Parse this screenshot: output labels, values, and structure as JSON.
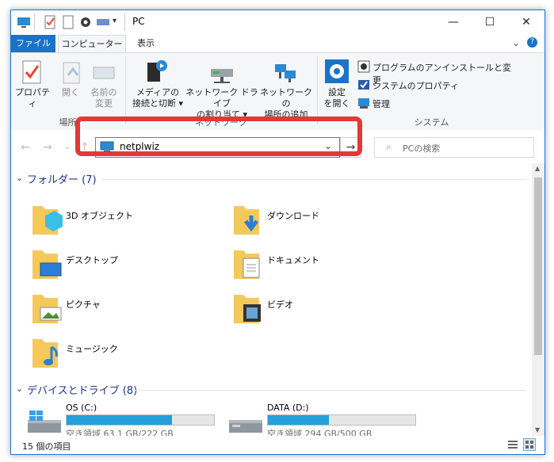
{
  "window": {
    "title": "PC"
  },
  "window_controls": {
    "minimize": "—",
    "maximize": "☐",
    "close": "✕"
  },
  "tabs": [
    {
      "label": "ファイル"
    },
    {
      "label": "コンピューター"
    },
    {
      "label": "表示"
    }
  ],
  "ribbon": {
    "groups": [
      {
        "label": "場所"
      },
      {
        "label": "ネットワーク"
      },
      {
        "label": "システム"
      }
    ],
    "place": {
      "properties": [
        "プロパティ"
      ],
      "open": [
        "開く"
      ],
      "rename": [
        "名前の",
        "変更"
      ]
    },
    "network": {
      "media": [
        "メディアの",
        "接続と切断 ▾"
      ],
      "map_drive": [
        "ネットワーク ドライブ",
        "の割り当て ▾"
      ],
      "add_location": [
        "ネットワークの",
        "場所の追加"
      ]
    },
    "system": {
      "open_settings": [
        "設定",
        "を開く"
      ],
      "uninstall": "プログラムのアンインストールと変更",
      "system_properties": "システムのプロパティ",
      "manage": "管理"
    }
  },
  "address": {
    "value": "netplwiz"
  },
  "search": {
    "placeholder": "PCの検索"
  },
  "sections": {
    "folders_header": "フォルダー (7)",
    "devices_header": "デバイスとドライブ (8)"
  },
  "folders": [
    {
      "label": "3D オブジェクト",
      "icon": "3d-objects-icon"
    },
    {
      "label": "ダウンロード",
      "icon": "downloads-icon"
    },
    {
      "label": "デスクトップ",
      "icon": "desktop-icon"
    },
    {
      "label": "ドキュメント",
      "icon": "documents-icon"
    },
    {
      "label": "ピクチャ",
      "icon": "pictures-icon"
    },
    {
      "label": "ビデオ",
      "icon": "videos-icon"
    },
    {
      "label": "ミュージック",
      "icon": "music-icon"
    }
  ],
  "drives": [
    {
      "name": "OS (C:)",
      "free": "空き領域 63.1 GB/222 GB",
      "used_fraction": 0.716
    },
    {
      "name": "DATA (D:)",
      "free": "空き領域 294 GB/500 GB",
      "used_fraction": 0.412
    }
  ],
  "status": {
    "count": "15 個の項目"
  },
  "colors": {
    "accent": "#1a73c8",
    "highlight": "#e23838",
    "folder": "#f5c85b",
    "bar": "#26a0da"
  }
}
